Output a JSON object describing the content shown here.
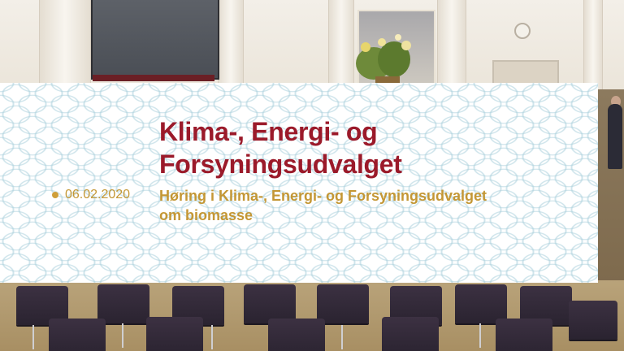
{
  "banner": {
    "title_line1": "Klima-, Energi- og",
    "title_line2": "Forsyningsudvalget",
    "date": "06.02.2020",
    "subtitle_line1": "Høring i Klima-, Energi- og Forsyningsudvalget",
    "subtitle_line2": "om biomasse"
  },
  "colors": {
    "title": "#9b1a2a",
    "accent": "#c49735",
    "pattern": "#aad0dc"
  }
}
